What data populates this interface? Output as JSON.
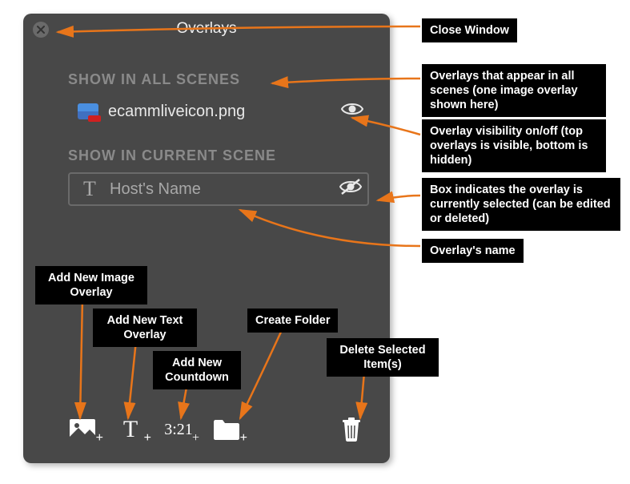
{
  "panel": {
    "title": "Overlays",
    "section_all": "SHOW IN ALL SCENES",
    "section_current": "SHOW IN CURRENT SCENE",
    "rows": {
      "image_overlay_name": "ecammliveicon.png",
      "text_overlay_name": "Host's Name"
    },
    "toolbar": {
      "countdown_label": "3:21"
    }
  },
  "annotations": {
    "close_window": "Close Window",
    "all_scenes": "Overlays that appear in all scenes (one image overlay shown here)",
    "visibility": "Overlay visibility on/off (top overlays is visible, bottom is hidden)",
    "selected_box": "Box indicates the overlay is currently selected (can be edited or deleted)",
    "overlay_name": "Overlay's name",
    "add_image": "Add New Image Overlay",
    "add_text": "Add New Text Overlay",
    "add_countdown": "Add New Countdown",
    "create_folder": "Create Folder",
    "delete_selected": "Delete Selected Item(s)"
  }
}
